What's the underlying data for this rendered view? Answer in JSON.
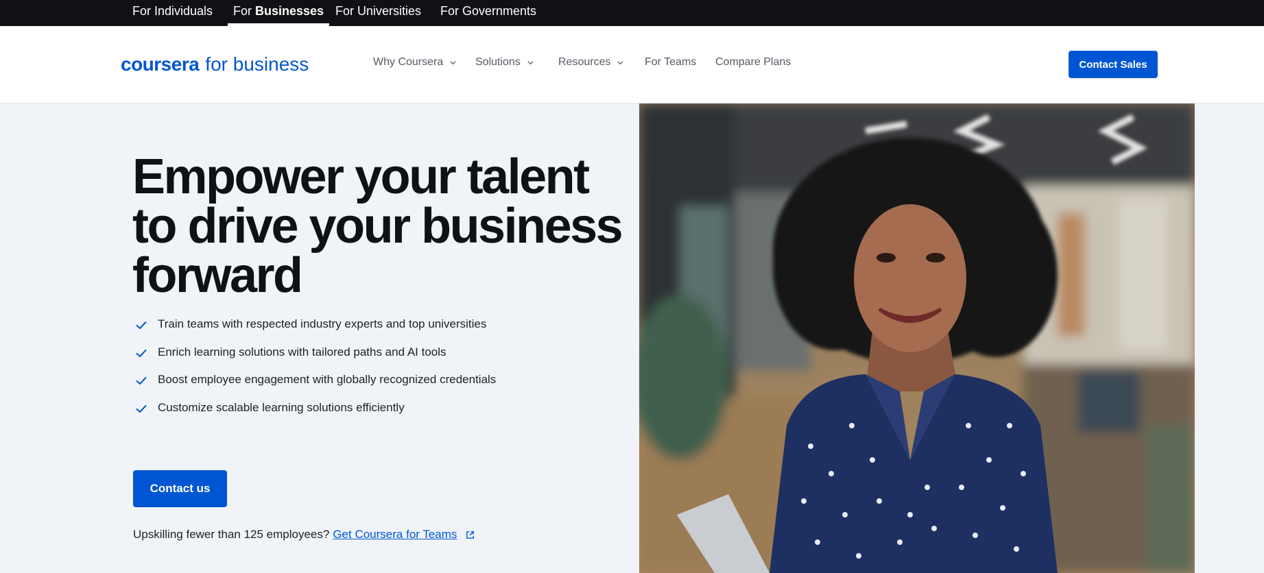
{
  "audience_bar": {
    "items": [
      {
        "label": "For Individuals"
      },
      {
        "prefix": "For",
        "label": "Businesses"
      },
      {
        "label": "For Universities"
      },
      {
        "label": "For Governments"
      }
    ]
  },
  "header": {
    "logo_brand": "coursera",
    "logo_sub": "for business",
    "nav": [
      {
        "label": "Why Coursera",
        "icon": "chevron-down-icon"
      },
      {
        "label": "Solutions",
        "icon": "chevron-down-icon"
      },
      {
        "label": "Resources",
        "icon": "chevron-down-icon"
      },
      {
        "label": "For Teams"
      },
      {
        "label": "Compare Plans"
      }
    ],
    "cta_label": "Contact Sales"
  },
  "hero": {
    "title_lines": [
      "Empower your talent",
      "to drive your business",
      "forward"
    ],
    "features": [
      "Train teams with respected industry experts and top universities",
      "Enrich learning solutions with tailored paths and AI tools",
      "Boost employee engagement with globally recognized credentials",
      "Customize scalable learning solutions efficiently"
    ],
    "contact_label": "Contact us",
    "teams_prompt": "Upskilling fewer than 125 employees?",
    "teams_link": "Get Coursera for Teams"
  },
  "colors": {
    "brand_blue": "#0056d2",
    "top_bar": "#0f1114",
    "hero_bg": "#f0f4f9"
  }
}
